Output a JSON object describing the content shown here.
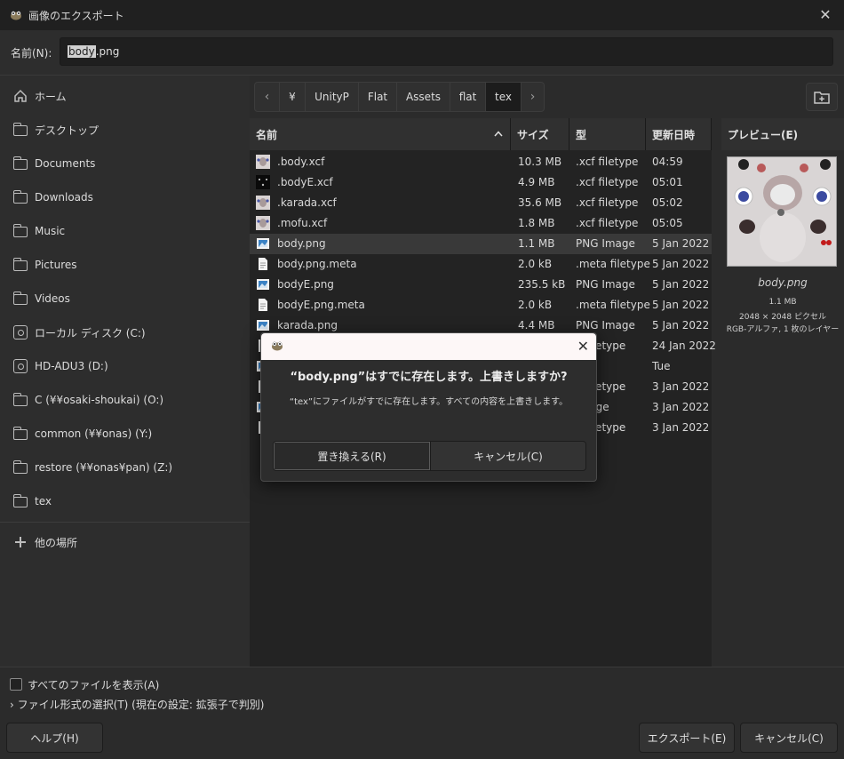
{
  "window": {
    "title": "画像のエクスポート",
    "close_glyph": "✕"
  },
  "name_row": {
    "label": "名前(N):",
    "value_selected": "body",
    "value_rest": ".png"
  },
  "sidebar": {
    "items": [
      {
        "label": "ホーム",
        "icon": "home-icon"
      },
      {
        "label": "デスクトップ",
        "icon": "folder-icon"
      },
      {
        "label": "Documents",
        "icon": "folder-icon"
      },
      {
        "label": "Downloads",
        "icon": "folder-icon"
      },
      {
        "label": "Music",
        "icon": "folder-icon"
      },
      {
        "label": "Pictures",
        "icon": "folder-icon"
      },
      {
        "label": "Videos",
        "icon": "folder-icon"
      },
      {
        "label": "ローカル ディスク (C:)",
        "icon": "disk-icon"
      },
      {
        "label": "HD-ADU3 (D:)",
        "icon": "disk-icon"
      },
      {
        "label": "C (¥¥osaki-shoukai) (O:)",
        "icon": "folder-icon"
      },
      {
        "label": "common (¥¥onas) (Y:)",
        "icon": "folder-icon"
      },
      {
        "label": "restore (¥¥onas¥pan) (Z:)",
        "icon": "folder-icon"
      },
      {
        "label": "tex",
        "icon": "folder-icon"
      }
    ],
    "other_places": "他の場所"
  },
  "pathbar": {
    "left_arrow": "‹",
    "right_arrow": "›",
    "crumbs": [
      "¥",
      "UnityP",
      "Flat",
      "Assets",
      "flat",
      "tex"
    ],
    "active": "tex"
  },
  "file_list": {
    "headers": {
      "name": "名前",
      "size": "サイズ",
      "type": "型",
      "modified": "更新日時"
    },
    "sort_glyph": "^",
    "rows": [
      {
        "name": ".body.xcf",
        "size": "10.3 MB",
        "type": ".xcf filetype",
        "modified": "04:59",
        "icon": "xcf-thumb-light"
      },
      {
        "name": ".bodyE.xcf",
        "size": "4.9 MB",
        "type": ".xcf filetype",
        "modified": "05:01",
        "icon": "xcf-thumb-dark"
      },
      {
        "name": ".karada.xcf",
        "size": "35.6 MB",
        "type": ".xcf filetype",
        "modified": "05:02",
        "icon": "xcf-thumb-light"
      },
      {
        "name": ".mofu.xcf",
        "size": "1.8 MB",
        "type": ".xcf filetype",
        "modified": "05:05",
        "icon": "xcf-thumb-light"
      },
      {
        "name": "body.png",
        "size": "1.1 MB",
        "type": "PNG Image",
        "modified": "5 Jan 2022",
        "icon": "image-icon"
      },
      {
        "name": "body.png.meta",
        "size": "2.0 kB",
        "type": ".meta filetype",
        "modified": "5 Jan 2022",
        "icon": "document-icon"
      },
      {
        "name": "bodyE.png",
        "size": "235.5 kB",
        "type": "PNG Image",
        "modified": "5 Jan 2022",
        "icon": "image-icon"
      },
      {
        "name": "bodyE.png.meta",
        "size": "2.0 kB",
        "type": ".meta filetype",
        "modified": "5 Jan 2022",
        "icon": "document-icon"
      },
      {
        "name": "karada.png",
        "size": "4.4 MB",
        "type": "PNG Image",
        "modified": "5 Jan 2022",
        "icon": "image-icon"
      },
      {
        "name": "",
        "size": "",
        "type": "a filetype",
        "modified": "24 Jan 2022",
        "icon": "document-icon"
      },
      {
        "name": "",
        "size": "",
        "type": "",
        "modified": "Tue",
        "icon": "image-icon"
      },
      {
        "name": "",
        "size": "",
        "type": "a filetype",
        "modified": "3 Jan 2022",
        "icon": "document-icon"
      },
      {
        "name": "",
        "size": "",
        "type": "Image",
        "modified": "3 Jan 2022",
        "icon": "image-icon"
      },
      {
        "name": "",
        "size": "",
        "type": "a filetype",
        "modified": "3 Jan 2022",
        "icon": "document-icon"
      }
    ],
    "selected_index": 4
  },
  "preview": {
    "header": "プレビュー(E)",
    "file_name": "body.png",
    "size": "1.1 MB",
    "dimensions": "2048 × 2048 ピクセル",
    "mode": "RGB-アルファ, 1 枚のレイヤー"
  },
  "bottom": {
    "show_all_label": "すべてのファイルを表示(A)",
    "show_all_checked": false,
    "file_type_label": "ファイル形式の選択(T) (現在の設定: 拡張子で判別)",
    "help_button": "ヘルプ(H)",
    "export_button": "エクスポート(E)",
    "cancel_button": "キャンセル(C)"
  },
  "dialog": {
    "close_glyph": "✕",
    "heading": "“body.png”はすでに存在します。上書きしますか?",
    "message": "“tex”にファイルがすでに存在します。すべての内容を上書きします。",
    "replace_button": "置き換える(R)",
    "cancel_button": "キャンセル(C)"
  },
  "colors": {
    "window_bg": "#2b2b2b",
    "list_bg": "#232323",
    "titlebar_bg": "#202020",
    "dialog_titlebar_bg": "#fdf7f7",
    "image_icon_blue": "#3b82c4"
  }
}
